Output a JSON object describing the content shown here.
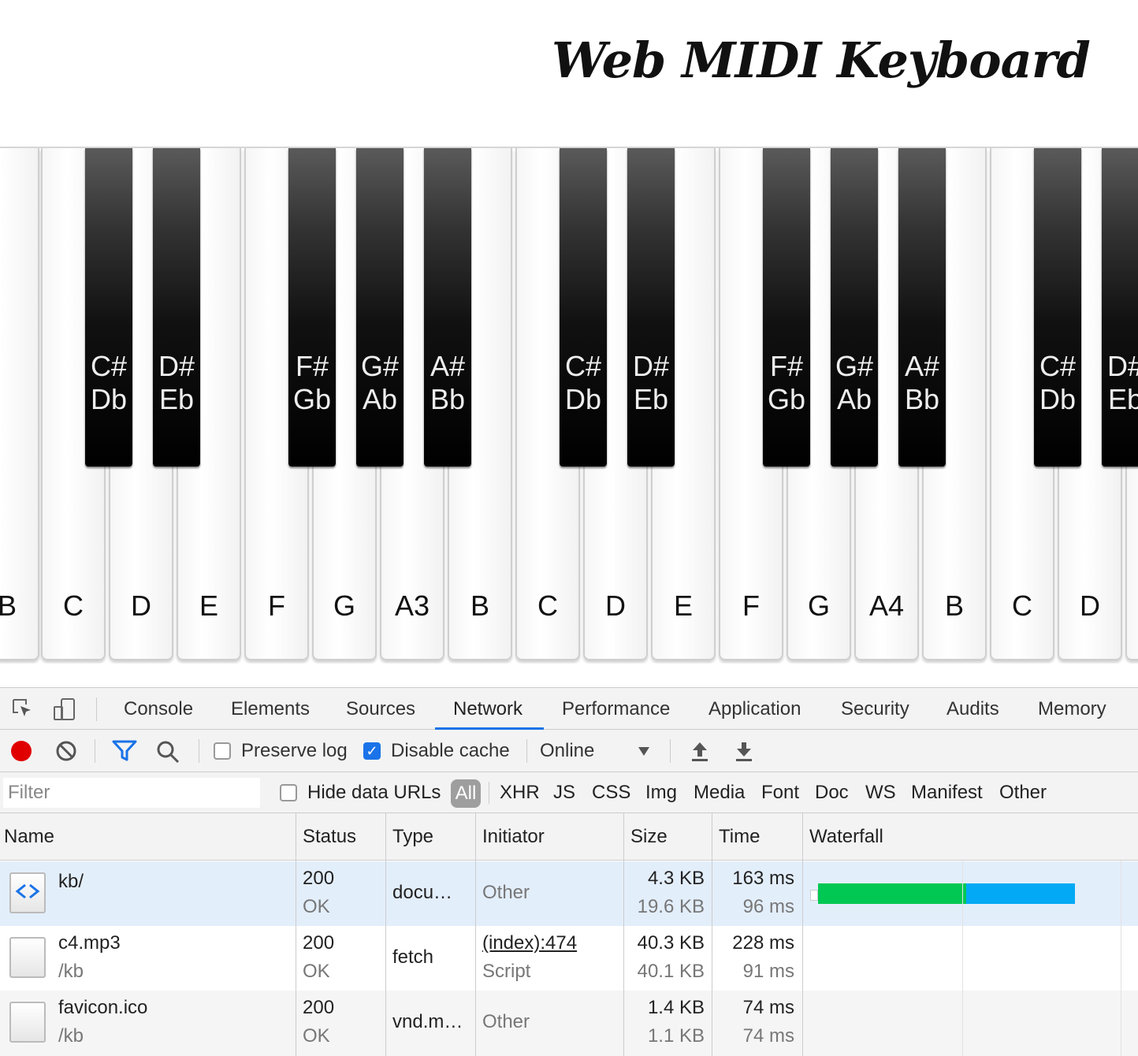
{
  "title": "Web MIDI Keyboard",
  "keyboard": {
    "white_keys": [
      "B",
      "C",
      "D",
      "E",
      "F",
      "G",
      "A3",
      "B",
      "C",
      "D",
      "E",
      "F",
      "G",
      "A4",
      "B",
      "C",
      "D",
      ""
    ],
    "black_keys": [
      {
        "sharp": "C#",
        "flat": "Db"
      },
      {
        "sharp": "D#",
        "flat": "Eb"
      },
      {
        "sharp": "F#",
        "flat": "Gb"
      },
      {
        "sharp": "G#",
        "flat": "Ab"
      },
      {
        "sharp": "A#",
        "flat": "Bb"
      },
      {
        "sharp": "C#",
        "flat": "Db"
      },
      {
        "sharp": "D#",
        "flat": "Eb"
      },
      {
        "sharp": "F#",
        "flat": "Gb"
      },
      {
        "sharp": "G#",
        "flat": "Ab"
      },
      {
        "sharp": "A#",
        "flat": "Bb"
      },
      {
        "sharp": "C#",
        "flat": "Db"
      },
      {
        "sharp": "D#",
        "flat": "Eb"
      }
    ]
  },
  "devtools": {
    "tabs": [
      "Console",
      "Elements",
      "Sources",
      "Network",
      "Performance",
      "Application",
      "Security",
      "Audits",
      "Memory"
    ],
    "active_tab": "Network",
    "toolbar": {
      "preserve_log": "Preserve log",
      "preserve_log_checked": false,
      "disable_cache": "Disable cache",
      "disable_cache_checked": true,
      "throttling": "Online"
    },
    "filter": {
      "placeholder": "Filter",
      "hide_data_urls": "Hide data URLs",
      "types": [
        "All",
        "XHR",
        "JS",
        "CSS",
        "Img",
        "Media",
        "Font",
        "Doc",
        "WS",
        "Manifest",
        "Other"
      ],
      "active_type": "All"
    },
    "table": {
      "columns": [
        "Name",
        "Status",
        "Type",
        "Initiator",
        "Size",
        "Time",
        "Waterfall"
      ],
      "rows": [
        {
          "name": "kb/",
          "path": "",
          "status": "200",
          "status_text": "OK",
          "type": "docu…",
          "initiator": "Other",
          "initiator_sub": "",
          "size": "4.3 KB",
          "size_sub": "19.6 KB",
          "time": "163 ms",
          "time_sub": "96 ms"
        },
        {
          "name": "c4.mp3",
          "path": "/kb",
          "status": "200",
          "status_text": "OK",
          "type": "fetch",
          "initiator": "(index):474",
          "initiator_sub": "Script",
          "size": "40.3 KB",
          "size_sub": "40.1 KB",
          "time": "228 ms",
          "time_sub": "91 ms"
        },
        {
          "name": "favicon.ico",
          "path": "/kb",
          "status": "200",
          "status_text": "OK",
          "type": "vnd.m…",
          "initiator": "Other",
          "initiator_sub": "",
          "size": "1.4 KB",
          "size_sub": "1.1 KB",
          "time": "74 ms",
          "time_sub": "74 ms"
        }
      ]
    },
    "colors": {
      "accent": "#1a73e8",
      "record": "#e00000",
      "waterfall_waiting": "#00c853",
      "waterfall_download": "#03a9f4",
      "selected_row": "#e3eefb"
    }
  }
}
